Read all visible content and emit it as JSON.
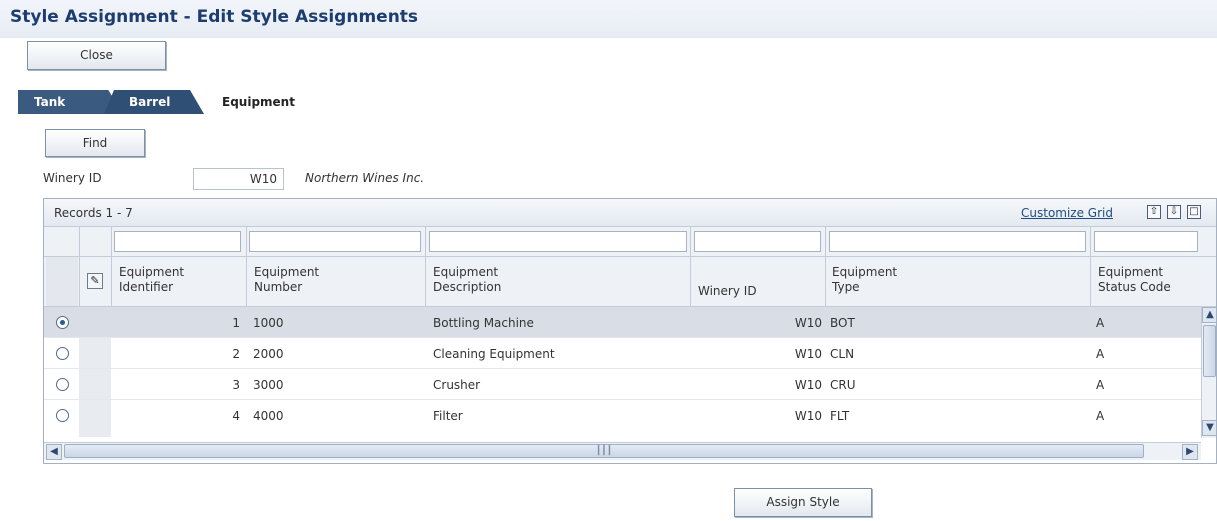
{
  "window": {
    "title": "Style Assignment - Edit Style Assignments"
  },
  "toolbar": {
    "close_label": "Close"
  },
  "tabs": {
    "tank": "Tank",
    "barrel": "Barrel",
    "equipment": "Equipment"
  },
  "search": {
    "find_label": "Find",
    "winery_label": "Winery ID",
    "winery_value": "W10",
    "winery_name": "Northern Wines Inc."
  },
  "grid": {
    "records_label": "Records 1 - 7",
    "customize_label": "Customize Grid",
    "icons": [
      "export-icon",
      "import-icon",
      "maximize-icon"
    ],
    "columns": [
      {
        "line1": "Equipment",
        "line2": "Identifier"
      },
      {
        "line1": "Equipment",
        "line2": "Number"
      },
      {
        "line1": "Equipment",
        "line2": "Description"
      },
      {
        "line1": "Winery ID",
        "line2": ""
      },
      {
        "line1": "Equipment",
        "line2": "Type"
      },
      {
        "line1": "Equipment",
        "line2": "Status Code"
      }
    ],
    "rows": [
      {
        "selected": true,
        "identifier": "1",
        "number": "1000",
        "description": "Bottling Machine",
        "winery": "W10",
        "type": "BOT",
        "status": "A"
      },
      {
        "selected": false,
        "identifier": "2",
        "number": "2000",
        "description": "Cleaning Equipment",
        "winery": "W10",
        "type": "CLN",
        "status": "A"
      },
      {
        "selected": false,
        "identifier": "3",
        "number": "3000",
        "description": "Crusher",
        "winery": "W10",
        "type": "CRU",
        "status": "A"
      },
      {
        "selected": false,
        "identifier": "4",
        "number": "4000",
        "description": "Filter",
        "winery": "W10",
        "type": "FLT",
        "status": "A"
      }
    ]
  },
  "actions": {
    "assign_style_label": "Assign Style"
  }
}
